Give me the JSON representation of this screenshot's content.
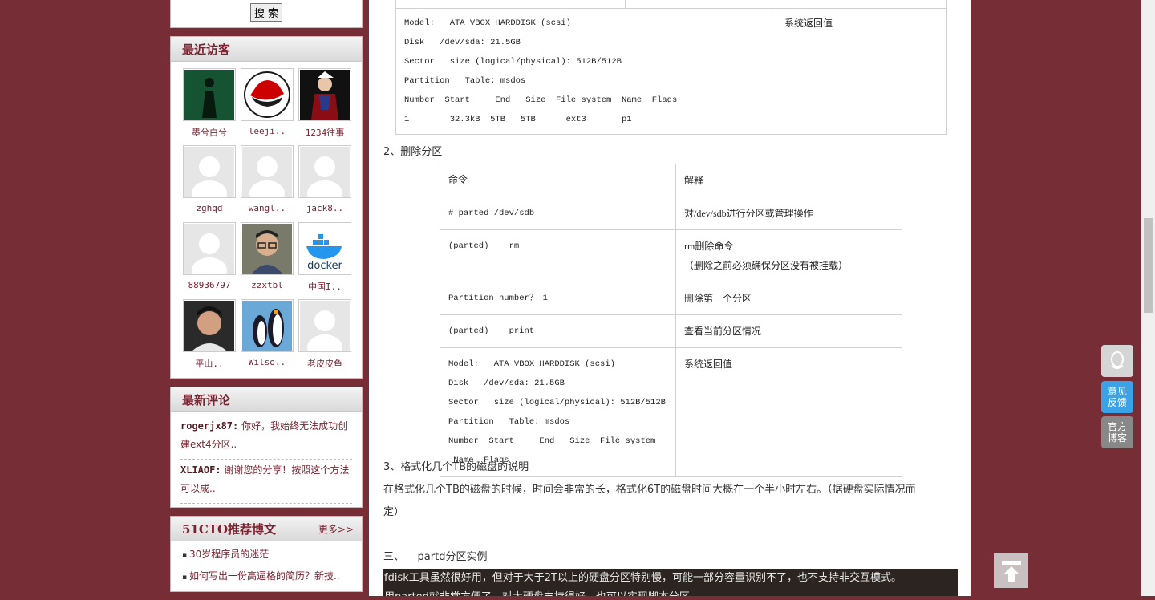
{
  "search": {
    "button": "搜 索"
  },
  "visitors": {
    "title": "最近访客",
    "items": [
      {
        "name": "墨兮白兮",
        "avatar": "matrix-figure"
      },
      {
        "name": "leeji..",
        "avatar": "redhat-logo"
      },
      {
        "name": "1234往事",
        "avatar": "anime-character"
      },
      {
        "name": "zghqd",
        "avatar": "default-user"
      },
      {
        "name": "wangl..",
        "avatar": "default-user"
      },
      {
        "name": "jack8..",
        "avatar": "default-user"
      },
      {
        "name": "88936797",
        "avatar": "default-user"
      },
      {
        "name": "zzxtbl",
        "avatar": "man-with-glasses"
      },
      {
        "name": "中国I..",
        "avatar": "docker-logo"
      },
      {
        "name": "平山..",
        "avatar": "man-portrait"
      },
      {
        "name": "Wilso..",
        "avatar": "penguins"
      },
      {
        "name": "老皮皮鱼",
        "avatar": "default-user"
      }
    ]
  },
  "comments": {
    "title": "最新评论",
    "items": [
      {
        "user": "rogerjx87:",
        "text": "你好，我始终无法成功创建ext4分区.."
      },
      {
        "user": "XLIAOF:",
        "text": "谢谢您的分享！按照这个方法可以成.."
      }
    ]
  },
  "recommend": {
    "title": "51CTO推荐博文",
    "more": "更多>>",
    "items": [
      "30岁程序员的迷茫",
      "如何写出一份高逼格的简历？新技.."
    ]
  },
  "table1": {
    "output": [
      "Model:   ATA VBOX HARDDISK (scsi)",
      "Disk   /dev/sda: 21.5GB",
      "Sector   size (logical/physical): 512B/512B",
      "Partition   Table: msdos",
      "Number  Start     End   Size  File system  Name  Flags",
      "1        32.3kB  5TB   5TB      ext3       p1"
    ],
    "note": "系统返回值"
  },
  "section2": {
    "heading": "2、删除分区"
  },
  "table2": {
    "header": [
      "命令",
      "解释"
    ],
    "rows": [
      {
        "cmd": "# parted /dev/sdb",
        "desc": "对/dev/sdb进行分区或管理操作"
      },
      {
        "cmd": "(parted)    rm",
        "desc": "rm删除命令",
        "desc2": "（删除之前必须确保分区没有被挂载）"
      },
      {
        "cmd": "Partition number？ 1",
        "desc": "删除第一个分区"
      },
      {
        "cmd": "(parted)    print",
        "desc": "查看当前分区情况"
      }
    ],
    "output": [
      "Model:   ATA VBOX HARDDISK (scsi)",
      "Disk   /dev/sda: 21.5GB",
      "Sector   size (logical/physical): 512B/512B",
      "Partition   Table: msdos",
      "Number  Start     End   Size  File system",
      " Name  Flags"
    ],
    "note": "系统返回值"
  },
  "section3": {
    "heading": "3、格式化几个TB的磁盘的说明",
    "para1": "在格式化几个TB的磁盘的时候，时间会非常的长，格式化6T的磁盘时间大概在一个半小时左右。（据硬盘实际情况而",
    "para2": "定）"
  },
  "section4": {
    "heading": "三、    partd分区实例",
    "dark1": "fdisk工具虽然很好用，但对于大于2T以上的硬盘分区特别慢，可能一部分容量识别不了，也不支持非交互模式。",
    "dark2": "用parted就非常方便了，对大硬盘支持得好，也可以实现脚本分区"
  },
  "float": {
    "feedback": "意见反馈",
    "blog": "官方博客"
  }
}
